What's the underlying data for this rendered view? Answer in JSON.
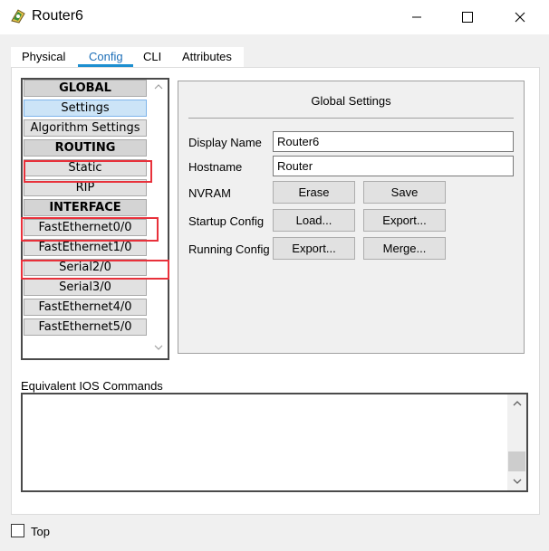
{
  "window": {
    "title": "Router6"
  },
  "tabs": [
    {
      "label": "Physical",
      "active": false
    },
    {
      "label": "Config",
      "active": true
    },
    {
      "label": "CLI",
      "active": false
    },
    {
      "label": "Attributes",
      "active": false
    }
  ],
  "sidebar": {
    "items": [
      {
        "label": "GLOBAL",
        "kind": "header"
      },
      {
        "label": "Settings",
        "kind": "item",
        "selected": true
      },
      {
        "label": "Algorithm Settings",
        "kind": "item"
      },
      {
        "label": "ROUTING",
        "kind": "header"
      },
      {
        "label": "Static",
        "kind": "item",
        "highlighted": true
      },
      {
        "label": "RIP",
        "kind": "item"
      },
      {
        "label": "INTERFACE",
        "kind": "header"
      },
      {
        "label": "FastEthernet0/0",
        "kind": "item",
        "highlighted": true
      },
      {
        "label": "FastEthernet1/0",
        "kind": "item"
      },
      {
        "label": "Serial2/0",
        "kind": "item",
        "highlighted": true
      },
      {
        "label": "Serial3/0",
        "kind": "item"
      },
      {
        "label": "FastEthernet4/0",
        "kind": "item"
      },
      {
        "label": "FastEthernet5/0",
        "kind": "item"
      }
    ]
  },
  "global_settings": {
    "title": "Global Settings",
    "display_name_label": "Display Name",
    "display_name_value": "Router6",
    "hostname_label": "Hostname",
    "hostname_value": "Router",
    "nvram_label": "NVRAM",
    "erase_label": "Erase",
    "save_label": "Save",
    "startup_label": "Startup Config",
    "load_label": "Load...",
    "startup_export_label": "Export...",
    "running_label": "Running Config",
    "running_export_label": "Export...",
    "merge_label": "Merge..."
  },
  "ios": {
    "label": "Equivalent IOS Commands",
    "content": ""
  },
  "bottom": {
    "top_label": "Top",
    "top_checked": false
  },
  "colors": {
    "highlight": "#e8313b",
    "active_tab": "#1d6fb8",
    "selected_item": "#cce4f7"
  },
  "icons": [
    "router-app-icon",
    "minimize-icon",
    "maximize-icon",
    "close-icon",
    "scroll-up-icon",
    "scroll-down-icon"
  ]
}
